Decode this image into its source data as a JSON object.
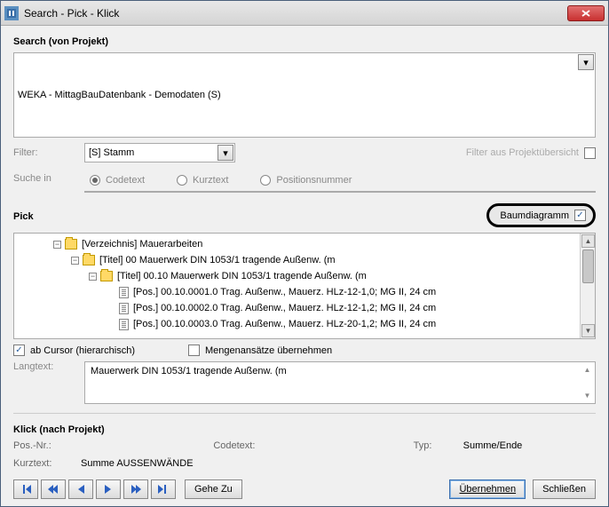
{
  "window": {
    "title": "Search - Pick - Klick"
  },
  "search": {
    "heading": "Search (von Projekt)",
    "project": "WEKA - MittagBauDatenbank - Demodaten (S)",
    "filter_label": "Filter:",
    "filter_value": "[S] Stamm",
    "filter_aus_label": "Filter aus Projektübersicht",
    "suche_in_label": "Suche in",
    "radios": {
      "codetext": "Codetext",
      "kurztext": "Kurztext",
      "positionsnummer": "Positionsnummer"
    }
  },
  "pick": {
    "heading": "Pick",
    "baum_label": "Baumdiagramm",
    "tree": {
      "n0": "[Verzeichnis]  Mauerarbeiten",
      "n1": "[Titel] 00 Mauerwerk DIN 1053/1 tragende Außenw. (m",
      "n2": "[Titel] 00.10 Mauerwerk DIN 1053/1 tragende Außenw. (m",
      "n3": "[Pos.] 00.10.0001.0 Trag. Außenw., Mauerz. HLz-12-1,0; MG II, 24 cm",
      "n4": "[Pos.] 00.10.0002.0 Trag. Außenw., Mauerz. HLz-12-1,2; MG II, 24 cm",
      "n5": "[Pos.] 00.10.0003.0 Trag. Außenw., Mauerz. HLz-20-1,2; MG II, 24 cm"
    },
    "ab_cursor": "ab Cursor (hierarchisch)",
    "mengen": "Mengenansätze übernehmen",
    "langtext_label": "Langtext:",
    "langtext_value": "Mauerwerk DIN 1053/1 tragende Außenw. (m"
  },
  "klick": {
    "heading": "Klick (nach Projekt)",
    "posnr_label": "Pos.-Nr.:",
    "posnr_value": "",
    "codetext_label": "Codetext:",
    "codetext_value": "",
    "typ_label": "Typ:",
    "typ_value": "Summe/Ende",
    "kurztext_label": "Kurztext:",
    "kurztext_value": "Summe AUSSENWÄNDE"
  },
  "footer": {
    "gehezu": "Gehe Zu",
    "uebernehmen": "Übernehmen",
    "schliessen": "Schließen"
  }
}
